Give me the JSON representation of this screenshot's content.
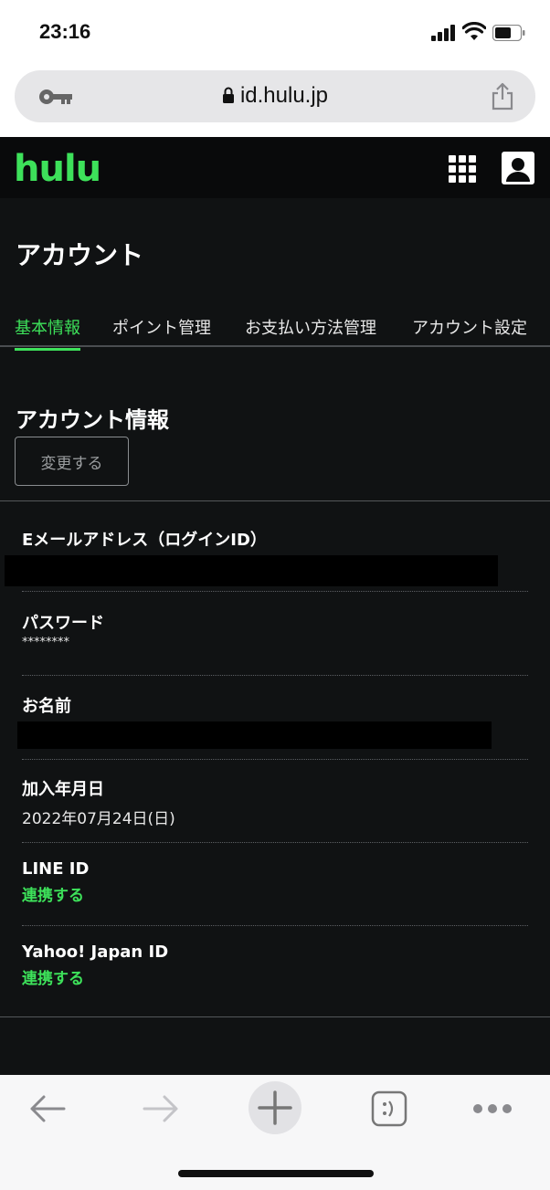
{
  "status_bar": {
    "time": "23:16"
  },
  "browser": {
    "url": "id.hulu.jp"
  },
  "app": {
    "logo": "hulu",
    "page_title": "アカウント",
    "tabs": [
      {
        "label": "基本情報",
        "active": true
      },
      {
        "label": "ポイント管理",
        "active": false
      },
      {
        "label": "お支払い方法管理",
        "active": false
      },
      {
        "label": "アカウント設定",
        "active": false
      }
    ],
    "section_title": "アカウント情報",
    "change_button": "変更する",
    "fields": {
      "email": {
        "label": "Eメールアドレス（ログインID）"
      },
      "password": {
        "label": "パスワード",
        "value": "********"
      },
      "name": {
        "label": "お名前"
      },
      "join_date": {
        "label": "加入年月日",
        "value": "2022年07月24日(日)"
      },
      "line": {
        "label": "LINE ID",
        "link": "連携する"
      },
      "yahoo": {
        "label": "Yahoo! Japan ID",
        "link": "連携する"
      }
    }
  },
  "colors": {
    "accent": "#3de15a",
    "background": "#101213",
    "header": "#090a0b"
  },
  "icons": [
    "key-icon",
    "lock-icon",
    "share-icon",
    "apps-grid-icon",
    "user-icon",
    "back-arrow-icon",
    "forward-arrow-icon",
    "new-tab-plus-icon",
    "tabs-icon",
    "more-icon"
  ]
}
